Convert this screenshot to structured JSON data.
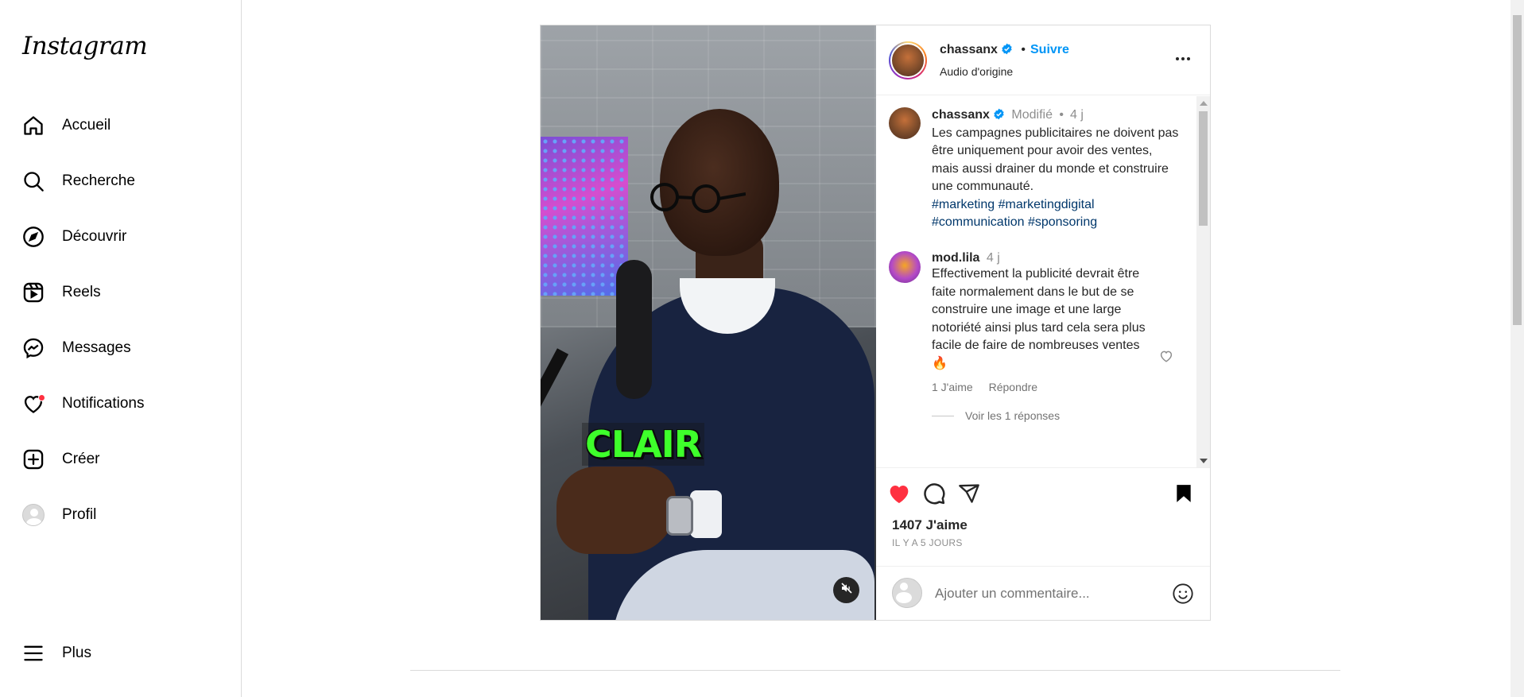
{
  "app": {
    "logo_text": "Instagram"
  },
  "sidebar": {
    "items": [
      {
        "label": "Accueil",
        "icon": "home-icon"
      },
      {
        "label": "Recherche",
        "icon": "search-icon"
      },
      {
        "label": "Découvrir",
        "icon": "compass-icon"
      },
      {
        "label": "Reels",
        "icon": "reels-icon"
      },
      {
        "label": "Messages",
        "icon": "messenger-icon"
      },
      {
        "label": "Notifications",
        "icon": "heart-icon"
      },
      {
        "label": "Créer",
        "icon": "plus-square-icon"
      },
      {
        "label": "Profil",
        "icon": "avatar-icon"
      }
    ],
    "more_label": "Plus"
  },
  "post": {
    "author": "chassanx",
    "separator": "•",
    "follow_label": "Suivre",
    "audio": "Audio d'origine",
    "video_caption": "CLAIR",
    "caption": {
      "author": "chassanx",
      "edited": "Modifié",
      "dot": "•",
      "age": "4 j",
      "text": "Les campagnes publicitaires ne doivent pas être uniquement pour avoir des ventes, mais aussi drainer du monde et construire une communauté.",
      "hashtags": [
        "#marketing",
        "#marketingdigital",
        "#communication",
        "#sponsoring"
      ]
    },
    "comments": [
      {
        "author": "mod.lila",
        "age": "4 j",
        "text": "Effectivement la publicité devrait être faite normalement dans le but de se construire une image et une large notoriété ainsi plus tard cela sera plus facile de faire de nombreuses ventes 🔥",
        "likes_label": "1 J'aime",
        "reply_label": "Répondre",
        "view_replies": "Voir les 1 réponses"
      }
    ],
    "likes": "1407 J'aime",
    "time_ago": "IL Y A 5 JOURS",
    "comment_placeholder": "Ajouter un commentaire...",
    "liked": true,
    "saved": true
  },
  "colors": {
    "accent": "#0095f6",
    "like": "#ff3040",
    "hashtag": "#00376b",
    "caption_green": "#3eff2b"
  }
}
